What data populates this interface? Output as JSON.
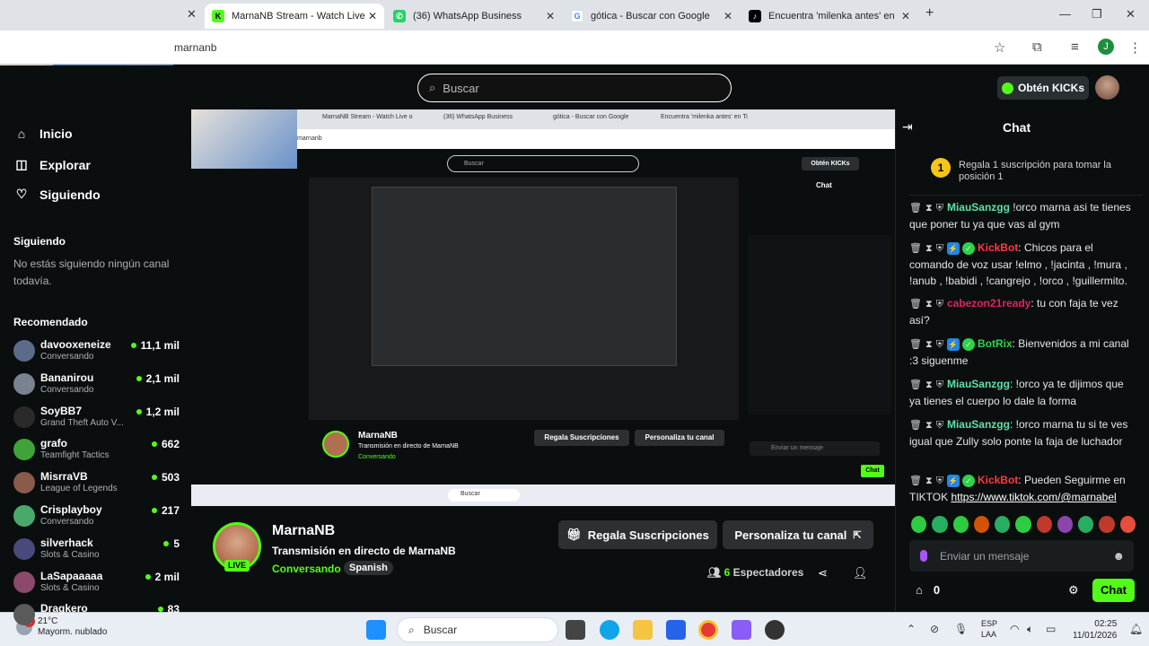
{
  "browser": {
    "tabs": [
      {
        "title": "MarnaNB Stream - Watch Live o",
        "active": true,
        "icon": "kick-icon"
      },
      {
        "title": "(36) WhatsApp Business",
        "active": false,
        "icon": "whatsapp-icon"
      },
      {
        "title": "gótica - Buscar con Google",
        "active": false,
        "icon": "google-icon"
      },
      {
        "title": "Encuentra 'milenka antes' en Ti",
        "active": false,
        "icon": "tiktok-icon"
      }
    ],
    "url": "marnanb",
    "new_tab": "+",
    "avatar_letter": "J"
  },
  "kick": {
    "search_placeholder": "Buscar",
    "get_kicks": "Obtén KICKs"
  },
  "sidebar": {
    "nav": [
      {
        "label": "Inicio",
        "icon": "home-icon"
      },
      {
        "label": "Explorar",
        "icon": "compass-icon"
      },
      {
        "label": "Siguiendo",
        "icon": "heart-icon"
      }
    ],
    "following_title": "Siguiendo",
    "following_empty": "No estás siguiendo ningún canal todavía.",
    "recommended_title": "Recomendado",
    "recommended": [
      {
        "name": "davooxeneize",
        "category": "Conversando",
        "viewers": "11,1 mil",
        "color": "#5b6c8a"
      },
      {
        "name": "Bananirou",
        "category": "Conversando",
        "viewers": "2,1 mil",
        "color": "#7a8290"
      },
      {
        "name": "SoyBB7",
        "category": "Grand Theft Auto V...",
        "viewers": "1,2 mil",
        "color": "#2a2a2a"
      },
      {
        "name": "grafo",
        "category": "Teamfight Tactics",
        "viewers": "662",
        "color": "#3fa33a"
      },
      {
        "name": "MisrraVB",
        "category": "League of Legends",
        "viewers": "503",
        "color": "#8a5a4a"
      },
      {
        "name": "Crisplayboy",
        "category": "Conversando",
        "viewers": "217",
        "color": "#4aa86a"
      },
      {
        "name": "silverhack",
        "category": "Slots & Casino",
        "viewers": "5",
        "color": "#4a4a7a"
      },
      {
        "name": "LaSapaaaaa",
        "category": "Slots & Casino",
        "viewers": "2 mil",
        "color": "#8a4a6a"
      },
      {
        "name": "Dragkero",
        "category": "",
        "viewers": "83",
        "color": "#5a5a5a"
      }
    ]
  },
  "stream": {
    "name": "MarnaNB",
    "title": "Transmisión en directo de MarnaNB",
    "category": "Conversando",
    "language": "Spanish",
    "live": "LIVE",
    "gift_button": "Regala Suscripciones",
    "customize_button": "Personaliza tu canal",
    "viewers_count": "6",
    "viewers_label": "Espectadores"
  },
  "chat": {
    "title": "Chat",
    "gift_num": "1",
    "gift_text": "Regala 1 suscripción para tomar la posición 1",
    "messages": [
      {
        "user": "MiauSanzgg",
        "color": "#5ee1a8",
        "text": " !orco marna asi te tienes que poner tu ya que vas al gym"
      },
      {
        "user": "KickBot",
        "color": "#ff3b3b",
        "text": ": Chicos para el comando de voz usar !elmo , !jacinta , !mura , !anub , !babidi , !cangrejo , !orco , !guillermito."
      },
      {
        "user": "cabezon21ready",
        "color": "#e0245e",
        "text": ": tu con faja te vez así?"
      },
      {
        "user": "BotRix",
        "color": "#2ed34a",
        "text": ": Bienvenidos a mi canal :3 siguenme"
      },
      {
        "user": "MiauSanzgg",
        "color": "#5ee1a8",
        "text": ": !orco ya te dijimos que ya tienes el cuerpo lo dale la forma"
      },
      {
        "user": "MiauSanzgg",
        "color": "#5ee1a8",
        "text": ": !orco marna tu si te ves igual que Zully solo ponte la faja de luchador"
      },
      {
        "user": "KickBot",
        "color": "#ff3b3b",
        "text": ": Pueden Seguirme en TIKTOK ",
        "link": "https://www.tiktok.com/@marnabel"
      }
    ],
    "input_placeholder": "Enviar un mensaje",
    "points": "0",
    "send": "Chat"
  },
  "taskbar": {
    "badge": "2",
    "temp": "21°C",
    "weather": "Mayorm. nublado",
    "search": "Buscar",
    "lang1": "ESP",
    "lang2": "LAA",
    "time": "02:25",
    "date": "11/01/2026"
  }
}
